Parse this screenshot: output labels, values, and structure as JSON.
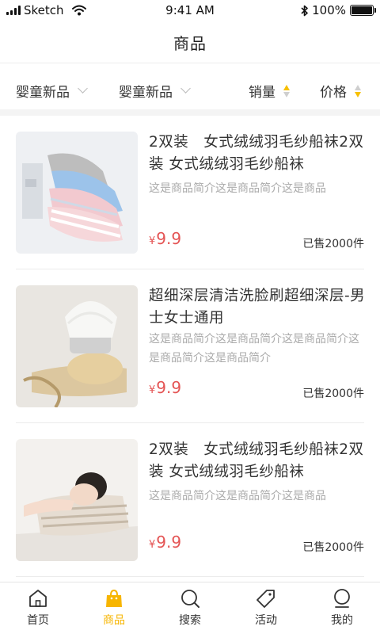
{
  "status_bar": {
    "carrier": "Sketch",
    "time": "9:41 AM",
    "battery": "100%"
  },
  "nav": {
    "title": "商品"
  },
  "filters": [
    {
      "label": "婴童新品",
      "kind": "dropdown"
    },
    {
      "label": "婴童新品",
      "kind": "dropdown"
    },
    {
      "label": "销量",
      "kind": "sort",
      "active_direction": "asc"
    },
    {
      "label": "价格",
      "kind": "sort",
      "active_direction": "desc"
    }
  ],
  "products": [
    {
      "title": "2双装　女式绒绒羽毛纱船袜2双装 女式绒绒羽毛纱船袜",
      "desc": "这是商品简介这是商品简介这是商品",
      "currency": "¥",
      "price": "9.9",
      "sold": "已售2000件",
      "image": "socks-icon"
    },
    {
      "title": "超细深层清洁洗脸刷超细深层-男士女士通用",
      "desc": "这是商品简介这是商品简介这是商品简介这是商品简介这是商品简介",
      "currency": "¥",
      "price": "9.9",
      "sold": "已售2000件",
      "image": "face-brush-icon"
    },
    {
      "title": "2双装　女式绒绒羽毛纱船袜2双装 女式绒绒羽毛纱船袜",
      "desc": "这是商品简介这是商品简介这是商品",
      "currency": "¥",
      "price": "9.9",
      "sold": "已售2000件",
      "image": "pillow-icon"
    }
  ],
  "tabbar": [
    {
      "label": "首页",
      "icon": "home-icon",
      "active": false
    },
    {
      "label": "商品",
      "icon": "bag-icon",
      "active": true
    },
    {
      "label": "搜索",
      "icon": "search-icon",
      "active": false
    },
    {
      "label": "活动",
      "icon": "tag-icon",
      "active": false
    },
    {
      "label": "我的",
      "icon": "user-icon",
      "active": false
    }
  ],
  "colors": {
    "accent": "#f7b500",
    "price": "#e45454",
    "muted": "#aaaaaa"
  }
}
